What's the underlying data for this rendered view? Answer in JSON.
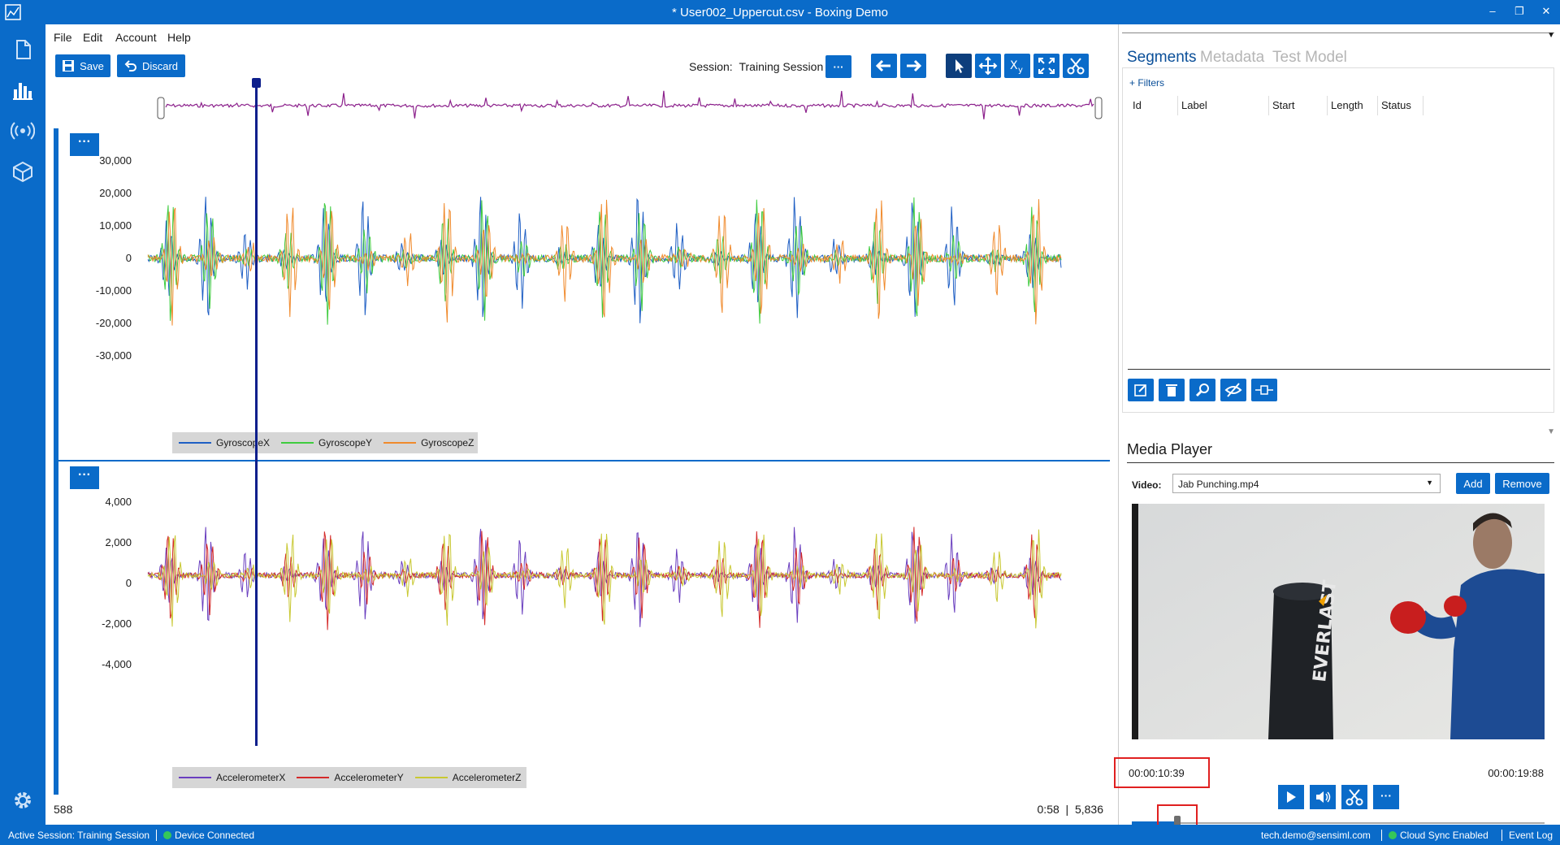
{
  "window": {
    "title": "* User002_Uppercut.csv - Boxing Demo"
  },
  "menu": {
    "items": [
      "File",
      "Edit",
      "Account",
      "Help"
    ]
  },
  "toolbar": {
    "save_label": "Save",
    "discard_label": "Discard",
    "session_label": "Session:",
    "session_value": "Training Session",
    "more_label": "···"
  },
  "plots": {
    "panel_menu_label": "···",
    "gyro": {
      "legend": [
        "GyroscopeX",
        "GyroscopeY",
        "GyroscopeZ"
      ],
      "yticks": [
        "30,000",
        "20,000",
        "10,000",
        "0",
        "-10,000",
        "-20,000",
        "-30,000"
      ]
    },
    "accel": {
      "legend": [
        "AccelerometerX",
        "AccelerometerY",
        "AccelerometerZ"
      ],
      "yticks": [
        "4,000",
        "2,000",
        "0",
        "-2,000",
        "-4,000"
      ]
    }
  },
  "status": {
    "left_value": "588",
    "right_value": "0:58  |  5,836"
  },
  "right": {
    "tabs": [
      "Segments",
      "Metadata",
      "Test Model"
    ],
    "filters_label": "+ Filters",
    "columns": [
      "Id",
      "Label",
      "Start",
      "Length",
      "Status"
    ],
    "media_title": "Media Player",
    "video_label": "Video:",
    "video_file": "Jab Punching.mp4",
    "add_label": "Add",
    "remove_label": "Remove",
    "current_time": "00:00:10:39",
    "total_time": "00:00:19:88",
    "more_label": "···",
    "playback_position": 0.11,
    "bag_text": "EVERLAST"
  },
  "footer": {
    "active_session": "Active Session:  Training Session",
    "device": "Device Connected",
    "email": "tech.demo@sensiml.com",
    "cloud": "Cloud Sync Enabled",
    "event_log": "Event Log"
  },
  "colors": {
    "accent": "#0a6bc9",
    "gyro": [
      "#1f5fc4",
      "#3fcc3f",
      "#f08a2c"
    ],
    "accel": [
      "#6a3fbf",
      "#d42a2a",
      "#c8c832"
    ],
    "overview": "#8b1f8b",
    "cursor": "#0d1f8c"
  },
  "icons": [
    "app-chart-icon",
    "file-icon",
    "bar-chart-icon",
    "broadcast-icon",
    "cube-icon",
    "gear-icon",
    "save-icon",
    "undo-icon",
    "arrow-left-icon",
    "arrow-right-icon",
    "pointer-icon",
    "move-icon",
    "xy-icon",
    "fit-icon",
    "scissors-icon",
    "edit-icon",
    "trash-icon",
    "zoom-icon",
    "hide-icon",
    "split-icon",
    "play-icon",
    "volume-icon"
  ]
}
